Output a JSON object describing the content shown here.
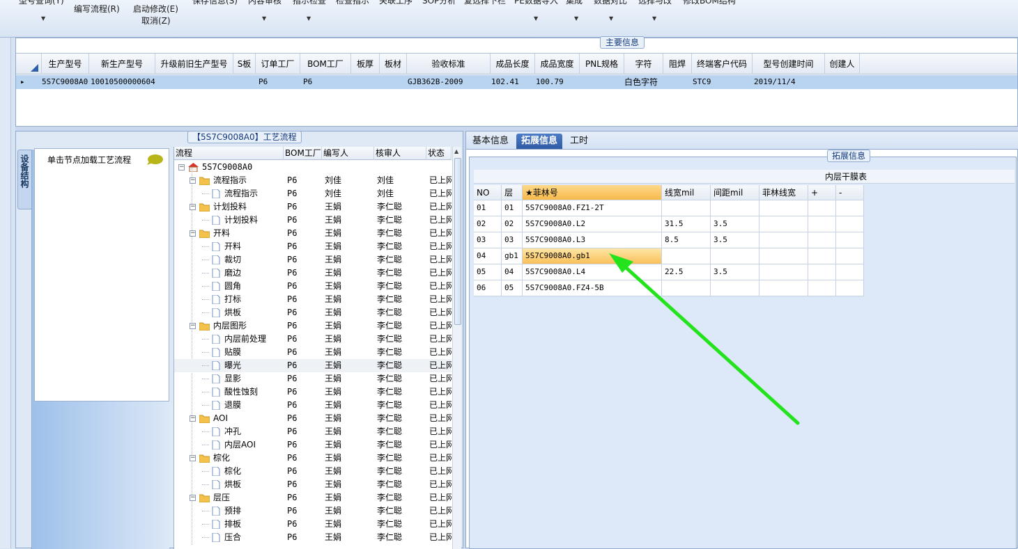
{
  "toolbar": {
    "cut_items": [
      "型号查询(Y)",
      "保存信息(S)",
      "内容审核",
      "指示检查",
      "检查指示",
      "关联工序",
      "SOP分析",
      "复选择下栏",
      "PE数据导入",
      "集成",
      "数据对比",
      "选择与改",
      "修改BOM结构"
    ],
    "write_flow": "编写流程(R)",
    "start_modify": "启动修改(E)",
    "cancel": "取消(Z)"
  },
  "main_info": {
    "title": "主要信息",
    "columns": [
      "生产型号",
      "新生产型号",
      "升级前旧生产型号",
      "S板",
      "订单工厂",
      "BOM工厂",
      "板厚",
      "板材",
      "验收标准",
      "成品长度",
      "成品宽度",
      "PNL规格",
      "字符",
      "阻焊",
      "终端客户代码",
      "型号创建时间",
      "创建人"
    ],
    "row": {
      "prod_model": "5S7C9008A0",
      "new_model": "10010500000604",
      "old_model": "",
      "s_board": "",
      "order_factory": "P6",
      "bom_factory": "P6",
      "thickness": "",
      "material": "",
      "standard": "GJB362B-2009",
      "length": "102.41",
      "width": "100.79",
      "pnl": "",
      "char": "白色字符",
      "solder": "",
      "customer": "STC9",
      "created": "2019/11/4",
      "creator": ""
    }
  },
  "process_panel": {
    "title": "【5S7C9008A0】工艺流程",
    "device_tab": "设备结构",
    "node_hint": "单击节点加载工艺流程",
    "columns": [
      "流程",
      "BOM工厂",
      "编写人",
      "核审人",
      "状态"
    ],
    "root": "5S7C9008A0",
    "rows": [
      {
        "name": "流程指示",
        "level": 1,
        "folder": true,
        "bom": "P6",
        "writer": "刘佳",
        "reviewer": "刘佳",
        "status": "已上网"
      },
      {
        "name": "流程指示",
        "level": 2,
        "folder": false,
        "bom": "P6",
        "writer": "刘佳",
        "reviewer": "刘佳",
        "status": "已上网"
      },
      {
        "name": "计划投料",
        "level": 1,
        "folder": true,
        "bom": "P6",
        "writer": "王娟",
        "reviewer": "李仁聪",
        "status": "已上网"
      },
      {
        "name": "计划投料",
        "level": 2,
        "folder": false,
        "bom": "P6",
        "writer": "王娟",
        "reviewer": "李仁聪",
        "status": "已上网"
      },
      {
        "name": "开料",
        "level": 1,
        "folder": true,
        "bom": "P6",
        "writer": "王娟",
        "reviewer": "李仁聪",
        "status": "已上网"
      },
      {
        "name": "开料",
        "level": 2,
        "folder": false,
        "bom": "P6",
        "writer": "王娟",
        "reviewer": "李仁聪",
        "status": "已上网"
      },
      {
        "name": "裁切",
        "level": 2,
        "folder": false,
        "bom": "P6",
        "writer": "王娟",
        "reviewer": "李仁聪",
        "status": "已上网"
      },
      {
        "name": "磨边",
        "level": 2,
        "folder": false,
        "bom": "P6",
        "writer": "王娟",
        "reviewer": "李仁聪",
        "status": "已上网"
      },
      {
        "name": "圆角",
        "level": 2,
        "folder": false,
        "bom": "P6",
        "writer": "王娟",
        "reviewer": "李仁聪",
        "status": "已上网"
      },
      {
        "name": "打标",
        "level": 2,
        "folder": false,
        "bom": "P6",
        "writer": "王娟",
        "reviewer": "李仁聪",
        "status": "已上网"
      },
      {
        "name": "烘板",
        "level": 2,
        "folder": false,
        "bom": "P6",
        "writer": "王娟",
        "reviewer": "李仁聪",
        "status": "已上网"
      },
      {
        "name": "内层图形",
        "level": 1,
        "folder": true,
        "bom": "P6",
        "writer": "王娟",
        "reviewer": "李仁聪",
        "status": "已上网"
      },
      {
        "name": "内层前处理",
        "level": 2,
        "folder": false,
        "bom": "P6",
        "writer": "王娟",
        "reviewer": "李仁聪",
        "status": "已上网"
      },
      {
        "name": "贴膜",
        "level": 2,
        "folder": false,
        "bom": "P6",
        "writer": "王娟",
        "reviewer": "李仁聪",
        "status": "已上网"
      },
      {
        "name": "曝光",
        "level": 2,
        "folder": false,
        "bom": "P6",
        "writer": "王娟",
        "reviewer": "李仁聪",
        "status": "已上网",
        "selected": true
      },
      {
        "name": "显影",
        "level": 2,
        "folder": false,
        "bom": "P6",
        "writer": "王娟",
        "reviewer": "李仁聪",
        "status": "已上网"
      },
      {
        "name": "酸性蚀刻",
        "level": 2,
        "folder": false,
        "bom": "P6",
        "writer": "王娟",
        "reviewer": "李仁聪",
        "status": "已上网"
      },
      {
        "name": "退膜",
        "level": 2,
        "folder": false,
        "bom": "P6",
        "writer": "王娟",
        "reviewer": "李仁聪",
        "status": "已上网"
      },
      {
        "name": "AOI",
        "level": 1,
        "folder": true,
        "bom": "P6",
        "writer": "王娟",
        "reviewer": "李仁聪",
        "status": "已上网"
      },
      {
        "name": "冲孔",
        "level": 2,
        "folder": false,
        "bom": "P6",
        "writer": "王娟",
        "reviewer": "李仁聪",
        "status": "已上网"
      },
      {
        "name": "内层AOI",
        "level": 2,
        "folder": false,
        "bom": "P6",
        "writer": "王娟",
        "reviewer": "李仁聪",
        "status": "已上网"
      },
      {
        "name": "棕化",
        "level": 1,
        "folder": true,
        "bom": "P6",
        "writer": "王娟",
        "reviewer": "李仁聪",
        "status": "已上网"
      },
      {
        "name": "棕化",
        "level": 2,
        "folder": false,
        "bom": "P6",
        "writer": "王娟",
        "reviewer": "李仁聪",
        "status": "已上网"
      },
      {
        "name": "烘板",
        "level": 2,
        "folder": false,
        "bom": "P6",
        "writer": "王娟",
        "reviewer": "李仁聪",
        "status": "已上网"
      },
      {
        "name": "层压",
        "level": 1,
        "folder": true,
        "bom": "P6",
        "writer": "王娟",
        "reviewer": "李仁聪",
        "status": "已上网"
      },
      {
        "name": "预排",
        "level": 2,
        "folder": false,
        "bom": "P6",
        "writer": "王娟",
        "reviewer": "李仁聪",
        "status": "已上网"
      },
      {
        "name": "排板",
        "level": 2,
        "folder": false,
        "bom": "P6",
        "writer": "王娟",
        "reviewer": "李仁聪",
        "status": "已上网"
      },
      {
        "name": "压合",
        "level": 2,
        "folder": false,
        "bom": "P6",
        "writer": "王娟",
        "reviewer": "李仁聪",
        "status": "已上网"
      }
    ]
  },
  "right_panel": {
    "tabs": [
      {
        "label": "基本信息",
        "active": false
      },
      {
        "label": "拓展信息",
        "active": true
      },
      {
        "label": "工时",
        "active": false
      }
    ],
    "ext_title": "拓展信息",
    "film_title": "内层干膜表",
    "film_columns": [
      "NO",
      "层",
      "★菲林号",
      "线宽mil",
      "间距mil",
      "菲林线宽",
      "+",
      "-"
    ],
    "film_rows": [
      {
        "no": "01",
        "layer": "01",
        "film": "5S7C9008A0.FZ1-2T",
        "lw": "",
        "sp": "",
        "flw": "",
        "highlight": false
      },
      {
        "no": "02",
        "layer": "02",
        "film": "5S7C9008A0.L2",
        "lw": "31.5",
        "sp": "3.5",
        "flw": "",
        "highlight": false
      },
      {
        "no": "03",
        "layer": "03",
        "film": "5S7C9008A0.L3",
        "lw": "8.5",
        "sp": "3.5",
        "flw": "",
        "highlight": false
      },
      {
        "no": "04",
        "layer": "gb1",
        "film": "5S7C9008A0.gb1",
        "lw": "",
        "sp": "",
        "flw": "",
        "highlight": true
      },
      {
        "no": "05",
        "layer": "04",
        "film": "5S7C9008A0.L4",
        "lw": "22.5",
        "sp": "3.5",
        "flw": "",
        "highlight": false
      },
      {
        "no": "06",
        "layer": "05",
        "film": "5S7C9008A0.FZ4-5B",
        "lw": "",
        "sp": "",
        "flw": "",
        "highlight": false
      }
    ]
  },
  "colors": {
    "accent_blue": "#2f5aa4",
    "selection_row": "#b9d4f0",
    "highlight_orange": "#f9c05a",
    "annotation_arrow": "#22e31c"
  },
  "icons": [
    "dropdown-arrow-icon",
    "row-indicator-icon",
    "corner-sort-icon",
    "bubble-icon",
    "home-icon",
    "folder-icon",
    "document-icon",
    "expand-toggle-icon",
    "scroll-up-icon",
    "annotation-arrow"
  ]
}
